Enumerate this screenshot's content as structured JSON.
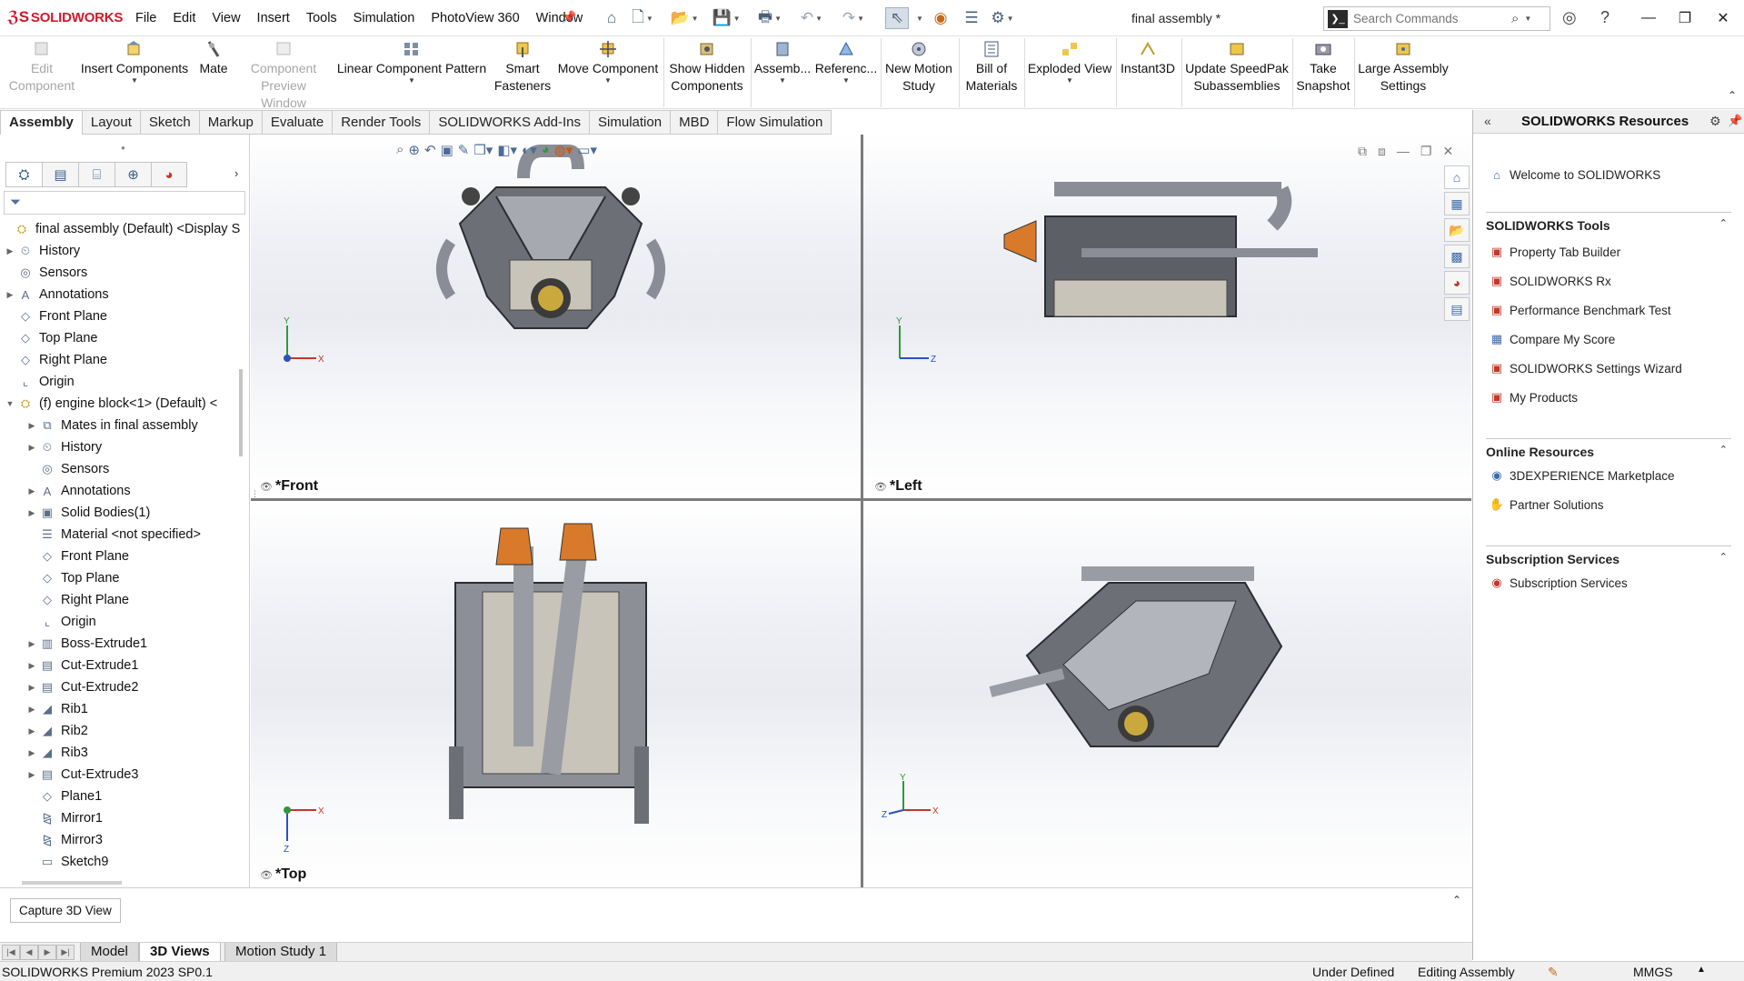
{
  "app": {
    "logo": "SOLIDWORKS",
    "document_title": "final assembly *",
    "brand_color": "#d3172c",
    "accent_color": "#4a6c9b"
  },
  "menu": [
    "File",
    "Edit",
    "View",
    "Insert",
    "Tools",
    "Simulation",
    "PhotoView 360",
    "Window"
  ],
  "search": {
    "placeholder": "Search Commands"
  },
  "ribbon": [
    {
      "label1": "Edit",
      "label2": "Component",
      "icon": "edit-component-icon",
      "disabled": true
    },
    {
      "label1": "Insert Components",
      "label2": "",
      "icon": "insert-components-icon",
      "disabled": false
    },
    {
      "label1": "Mate",
      "label2": "",
      "icon": "mate-icon",
      "disabled": false
    },
    {
      "label1": "Component",
      "label2": "Preview Window",
      "icon": "component-preview-icon",
      "disabled": true
    },
    {
      "label1": "Linear Component Pattern",
      "label2": "",
      "icon": "linear-pattern-icon",
      "disabled": false
    },
    {
      "label1": "Smart",
      "label2": "Fasteners",
      "icon": "smart-fasteners-icon",
      "disabled": false
    },
    {
      "label1": "Move Component",
      "label2": "",
      "icon": "move-component-icon",
      "disabled": false
    },
    {
      "label1": "Show Hidden",
      "label2": "Components",
      "icon": "show-hidden-icon",
      "disabled": false
    },
    {
      "label1": "Assemb...",
      "label2": "",
      "icon": "assembly-features-icon",
      "disabled": false
    },
    {
      "label1": "Referenc...",
      "label2": "",
      "icon": "reference-geometry-icon",
      "disabled": false
    },
    {
      "label1": "New Motion",
      "label2": "Study",
      "icon": "motion-study-icon",
      "disabled": false
    },
    {
      "label1": "Bill of",
      "label2": "Materials",
      "icon": "bom-icon",
      "disabled": false
    },
    {
      "label1": "Exploded View",
      "label2": "",
      "icon": "exploded-view-icon",
      "disabled": false
    },
    {
      "label1": "Instant3D",
      "label2": "",
      "icon": "instant3d-icon",
      "disabled": false
    },
    {
      "label1": "Update SpeedPak",
      "label2": "Subassemblies",
      "icon": "speedpak-icon",
      "disabled": false
    },
    {
      "label1": "Take",
      "label2": "Snapshot",
      "icon": "snapshot-icon",
      "disabled": false
    },
    {
      "label1": "Large Assembly",
      "label2": "Settings",
      "icon": "large-assembly-icon",
      "disabled": false
    }
  ],
  "command_tabs": [
    "Assembly",
    "Layout",
    "Sketch",
    "Markup",
    "Evaluate",
    "Render Tools",
    "SOLIDWORKS Add-Ins",
    "Simulation",
    "MBD",
    "Flow Simulation"
  ],
  "active_command_tab": "Assembly",
  "tree": [
    {
      "label": "final assembly (Default) <Display S",
      "icon": "assembly-icon",
      "indent": 0,
      "expander": ""
    },
    {
      "label": "History",
      "icon": "history-icon",
      "indent": 1,
      "expander": "▶"
    },
    {
      "label": "Sensors",
      "icon": "sensor-icon",
      "indent": 1,
      "expander": ""
    },
    {
      "label": "Annotations",
      "icon": "annotation-icon",
      "indent": 1,
      "expander": "▶"
    },
    {
      "label": "Front Plane",
      "icon": "plane-icon",
      "indent": 1,
      "expander": ""
    },
    {
      "label": "Top Plane",
      "icon": "plane-icon",
      "indent": 1,
      "expander": ""
    },
    {
      "label": "Right Plane",
      "icon": "plane-icon",
      "indent": 1,
      "expander": ""
    },
    {
      "label": "Origin",
      "icon": "origin-icon",
      "indent": 1,
      "expander": ""
    },
    {
      "label": "(f) engine block<1> (Default) <",
      "icon": "part-icon",
      "indent": 1,
      "expander": "▼"
    },
    {
      "label": "Mates in final assembly",
      "icon": "mates-icon",
      "indent": 2,
      "expander": "▶"
    },
    {
      "label": "History",
      "icon": "history-icon",
      "indent": 2,
      "expander": "▶"
    },
    {
      "label": "Sensors",
      "icon": "sensor-icon",
      "indent": 2,
      "expander": ""
    },
    {
      "label": "Annotations",
      "icon": "annotation-icon",
      "indent": 2,
      "expander": "▶"
    },
    {
      "label": "Solid Bodies(1)",
      "icon": "solid-bodies-icon",
      "indent": 2,
      "expander": "▶"
    },
    {
      "label": "Material <not specified>",
      "icon": "material-icon",
      "indent": 2,
      "expander": ""
    },
    {
      "label": "Front Plane",
      "icon": "plane-icon",
      "indent": 2,
      "expander": ""
    },
    {
      "label": "Top Plane",
      "icon": "plane-icon",
      "indent": 2,
      "expander": ""
    },
    {
      "label": "Right Plane",
      "icon": "plane-icon",
      "indent": 2,
      "expander": ""
    },
    {
      "label": "Origin",
      "icon": "origin-icon",
      "indent": 2,
      "expander": ""
    },
    {
      "label": "Boss-Extrude1",
      "icon": "extrude-icon",
      "indent": 2,
      "expander": "▶"
    },
    {
      "label": "Cut-Extrude1",
      "icon": "cut-extrude-icon",
      "indent": 2,
      "expander": "▶"
    },
    {
      "label": "Cut-Extrude2",
      "icon": "cut-extrude-icon",
      "indent": 2,
      "expander": "▶"
    },
    {
      "label": "Rib1",
      "icon": "rib-icon",
      "indent": 2,
      "expander": "▶"
    },
    {
      "label": "Rib2",
      "icon": "rib-icon",
      "indent": 2,
      "expander": "▶"
    },
    {
      "label": "Rib3",
      "icon": "rib-icon",
      "indent": 2,
      "expander": "▶"
    },
    {
      "label": "Cut-Extrude3",
      "icon": "cut-extrude-icon",
      "indent": 2,
      "expander": "▶"
    },
    {
      "label": "Plane1",
      "icon": "plane-icon",
      "indent": 2,
      "expander": ""
    },
    {
      "label": "Mirror1",
      "icon": "mirror-icon",
      "indent": 2,
      "expander": ""
    },
    {
      "label": "Mirror3",
      "icon": "mirror-icon",
      "indent": 2,
      "expander": ""
    },
    {
      "label": "Sketch9",
      "icon": "sketch-icon",
      "indent": 2,
      "expander": ""
    }
  ],
  "viewports": [
    {
      "label": "*Front",
      "axes": [
        "Y",
        "X"
      ]
    },
    {
      "label": "*Left",
      "axes": [
        "Y",
        "Z"
      ]
    },
    {
      "label": "*Top",
      "axes": [
        "X",
        "Z"
      ]
    },
    {
      "label": "",
      "axes": [
        "Y",
        "X",
        "Z"
      ]
    }
  ],
  "resources": {
    "title": "SOLIDWORKS Resources",
    "welcome": "Welcome to SOLIDWORKS",
    "sections": [
      {
        "title": "SOLIDWORKS Tools",
        "items": [
          "Property Tab Builder",
          "SOLIDWORKS Rx",
          "Performance Benchmark Test",
          "Compare My Score",
          "SOLIDWORKS Settings Wizard",
          "My Products"
        ]
      },
      {
        "title": "Online Resources",
        "items": [
          "3DEXPERIENCE Marketplace",
          "Partner Solutions"
        ]
      },
      {
        "title": "Subscription Services",
        "items": [
          "Subscription Services"
        ]
      }
    ]
  },
  "bottom": {
    "capture_button": "Capture 3D View",
    "tabs": [
      "Model",
      "3D Views",
      "Motion Study 1"
    ],
    "active_tab": "3D Views"
  },
  "status": {
    "product": "SOLIDWORKS Premium 2023 SP0.1",
    "state": "Under Defined",
    "mode": "Editing Assembly",
    "units": "MMGS"
  }
}
